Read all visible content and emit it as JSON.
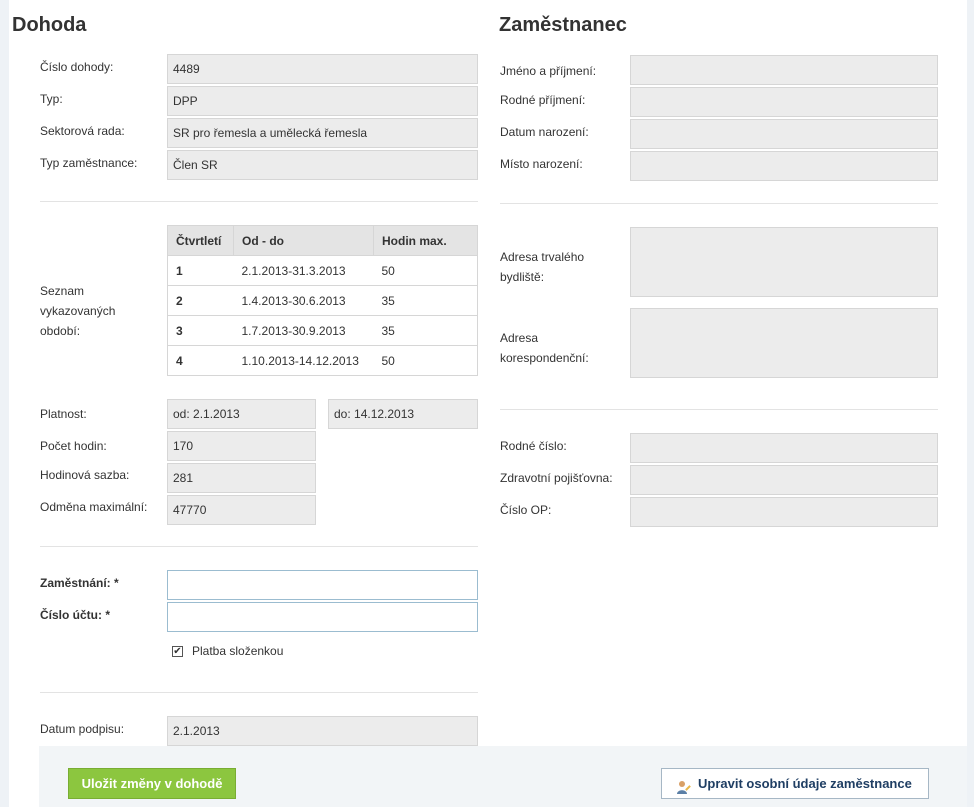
{
  "dohoda": {
    "title": "Dohoda",
    "fields": [
      {
        "label": "Číslo dohody:",
        "value": "4489"
      },
      {
        "label": "Typ:",
        "value": "DPP"
      },
      {
        "label": "Sektorová rada:",
        "value": "SR pro řemesla a umělecká řemesla"
      },
      {
        "label": "Typ zaměstnance:",
        "value": "Člen SR"
      }
    ],
    "periods_label_lines": [
      "Seznam",
      "vykazovaných",
      "období:"
    ],
    "periods": {
      "headers": [
        "Čtvrtletí",
        "Od - do",
        "Hodin max."
      ],
      "rows": [
        {
          "q": "1",
          "range": "2.1.2013-31.3.2013",
          "hours": "50"
        },
        {
          "q": "2",
          "range": "1.4.2013-30.6.2013",
          "hours": "35"
        },
        {
          "q": "3",
          "range": "1.7.2013-30.9.2013",
          "hours": "35"
        },
        {
          "q": "4",
          "range": "1.10.2013-14.12.2013",
          "hours": "50"
        }
      ]
    },
    "validity": {
      "label": "Platnost:",
      "from": "od: 2.1.2013",
      "to": "do: 14.12.2013"
    },
    "hours": {
      "label": "Počet hodin:",
      "value": "170"
    },
    "rate": {
      "label": "Hodinová sazba:",
      "value": "281"
    },
    "max_reward": {
      "label": "Odměna maximální:",
      "value": "47770"
    },
    "employment": {
      "label": "Zaměstnání: *",
      "value": ""
    },
    "account": {
      "label": "Číslo účtu: *",
      "value": ""
    },
    "payment": {
      "label": "Platba složenkou",
      "checked": true,
      "mark": "✔"
    },
    "signature": {
      "label": "Datum podpisu:",
      "value": "2.1.2013"
    }
  },
  "employee": {
    "title": "Zaměstnanec",
    "fields": [
      {
        "label": "Jméno a příjmení:",
        "value": ""
      },
      {
        "label": "Rodné příjmení:",
        "value": ""
      },
      {
        "label": "Datum narození:",
        "value": ""
      },
      {
        "label": "Místo narození:",
        "value": ""
      }
    ],
    "address_permanent_lines": [
      "Adresa trvalého",
      "bydliště:"
    ],
    "address_correspondence_lines": [
      "Adresa",
      "korespondenční:"
    ],
    "ids": [
      {
        "label": "Rodné číslo:",
        "value": ""
      },
      {
        "label": "Zdravotní pojišťovna:",
        "value": ""
      },
      {
        "label": "Číslo OP:",
        "value": ""
      }
    ]
  },
  "footer": {
    "save_label": "Uložit změny v dohodě",
    "edit_label": "Upravit osobní údaje zaměstnance",
    "edit_icon": "user-edit-icon"
  },
  "colors": {
    "save_button": "#8cc63f",
    "edit_button_text": "#1f3e63",
    "field_bg": "#ececec"
  }
}
